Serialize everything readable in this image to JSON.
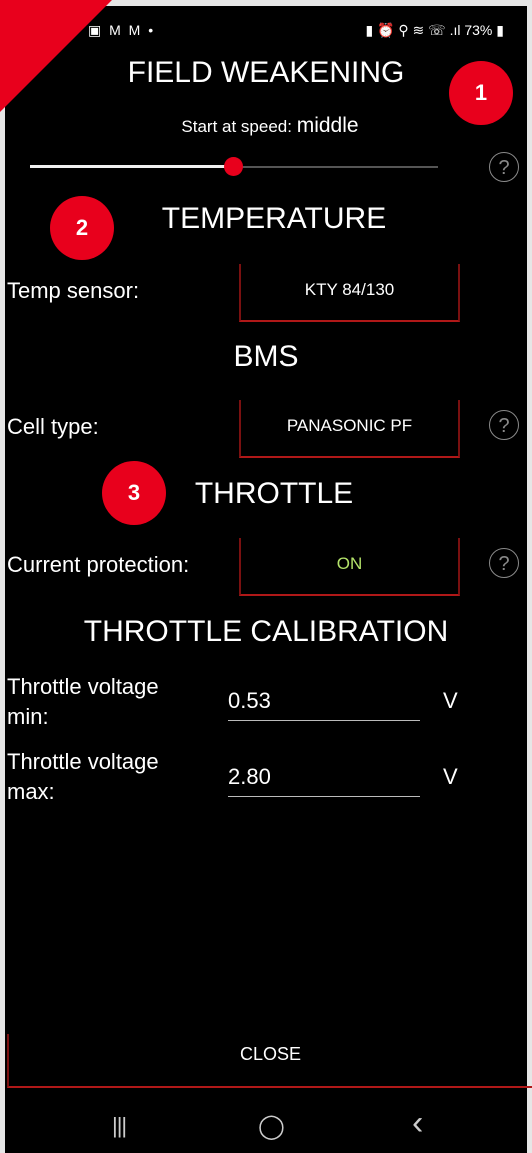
{
  "statusbar": {
    "left_icons": "▣ M M •",
    "right_icons": "▮ ⏰ ⚲ ≋ ☏ .ıl",
    "battery": "73%"
  },
  "field_weakening": {
    "title": "FIELD WEAKENING",
    "start_label": "Start at speed: ",
    "start_value": "middle",
    "slider_level": 0.5,
    "help": "?"
  },
  "temperature": {
    "title": "TEMPERATURE",
    "sensor_label": "Temp sensor:",
    "sensor_value": "KTY 84/130"
  },
  "bms": {
    "title": "BMS",
    "cell_label": "Cell type:",
    "cell_value": "PANASONIC PF",
    "help": "?"
  },
  "throttle": {
    "title": "THROTTLE",
    "protection_label": "Current protection:",
    "protection_value": "ON",
    "protection_color": "#b4e36a",
    "help": "?"
  },
  "calibration": {
    "title": "THROTTLE CALIBRATION",
    "min_label_1": "Throttle voltage",
    "min_label_2": "min:",
    "min_value": "0.53",
    "max_label_1": "Throttle voltage",
    "max_label_2": "max:",
    "max_value": "2.80",
    "unit": "V"
  },
  "badges": [
    "1",
    "2",
    "3"
  ],
  "close_label": "CLOSE",
  "navbar": {
    "recents": "|||",
    "home": "◯",
    "back": "‹"
  }
}
